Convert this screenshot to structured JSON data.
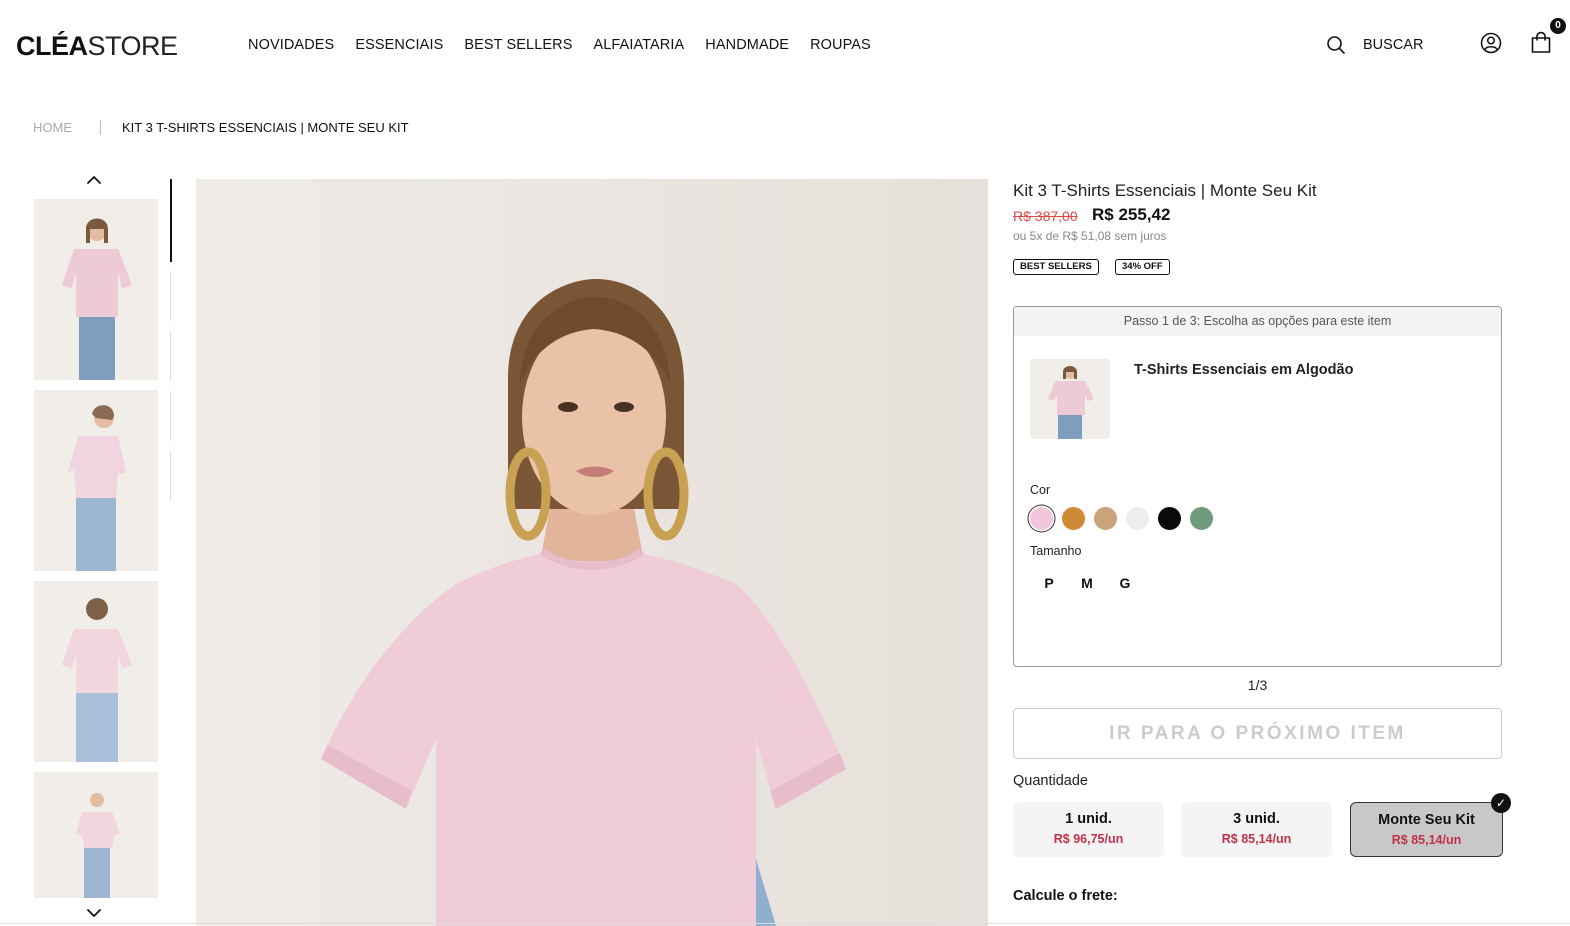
{
  "header": {
    "logo_bold": "CLÉA",
    "logo_light": "STORE",
    "nav": [
      "NOVIDADES",
      "ESSENCIAIS",
      "BEST SELLERS",
      "ALFAIATARIA",
      "HANDMADE",
      "ROUPAS"
    ],
    "search_label": "BUSCAR",
    "cart_count": "0",
    "icons": [
      "search-icon",
      "user-icon",
      "cart-icon"
    ]
  },
  "breadcrumb": {
    "home": "HOME",
    "current": "KIT 3 T-SHIRTS ESSENCIAIS | MONTE SEU KIT"
  },
  "product": {
    "title": "Kit 3 T-Shirts Essenciais | Monte Seu Kit",
    "old_price": "R$ 387,00",
    "price": "R$ 255,42",
    "installments": "ou 5x de R$ 51,08 sem juros",
    "badges": [
      "BEST SELLERS",
      "34% OFF"
    ]
  },
  "step": {
    "header": "Passo 1 de 3: Escolha as opções para este item",
    "item_name": "T-Shirts Essenciais em Algodão",
    "color_label": "Cor",
    "colors": [
      "#f2c6dc",
      "#cf8a36",
      "#c9a37a",
      "#ededed",
      "#0a0a0a",
      "#6f9a7c"
    ],
    "selected_color_index": 0,
    "size_label": "Tamanho",
    "sizes": [
      "P",
      "M",
      "G"
    ],
    "counter": "1/3",
    "next_button": "IR PARA O PRÓXIMO ITEM"
  },
  "quantity": {
    "label": "Quantidade",
    "options": [
      {
        "title": "1 unid.",
        "price": "R$ 96,75/un"
      },
      {
        "title": "3 unid.",
        "price": "R$ 85,14/un"
      },
      {
        "title": "Monte Seu Kit",
        "price": "R$ 85,14/un"
      }
    ],
    "selected_index": 2,
    "check_mark": "✓"
  },
  "shipping": {
    "label": "Calcule o frete:"
  },
  "colors": {
    "accent_price": "#c0324a",
    "strike_price": "#e04848",
    "shirt_pink": "#f0cbd8"
  }
}
